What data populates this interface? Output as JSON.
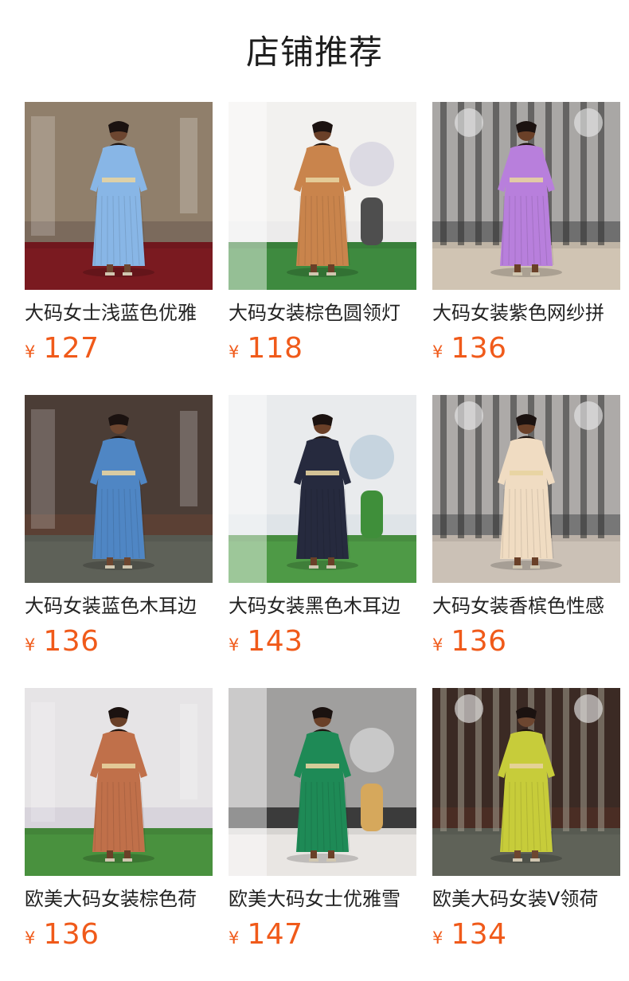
{
  "header": {
    "title": "店铺推荐"
  },
  "currency_symbol": "¥",
  "colors": {
    "price": "#f05a1a",
    "text": "#222222"
  },
  "products": [
    {
      "name": "大码女士浅蓝色优雅",
      "price": "127",
      "image": "woman-light-blue-dress-photo",
      "scene": {
        "bg": "#7b6a5c",
        "floor": "#7a1a20",
        "wall": "#a29078",
        "dress": "#88b6e6",
        "skin": "#6d4630",
        "accent": "#efe7da",
        "plants": "#2d7a34"
      }
    },
    {
      "name": "大码女装棕色圆领灯",
      "price": "118",
      "image": "woman-brown-pleated-dress-photo",
      "scene": {
        "bg": "#ecebeb",
        "floor": "#3e8a3f",
        "wall": "#f7f5f2",
        "dress": "#c9844c",
        "skin": "#6a4028",
        "accent": "#d8d6e0",
        "plants": "#4e4e4e"
      }
    },
    {
      "name": "大码女装紫色网纱拼",
      "price": "136",
      "image": "woman-purple-gown-photo",
      "scene": {
        "bg": "#6f6f6f",
        "floor": "#d0c4b3",
        "wall": "#d9d6d1",
        "dress": "#b87fdc",
        "skin": "#6a4028",
        "accent": "#2e2e2e",
        "plants": "#9a8870"
      }
    },
    {
      "name": "大码女装蓝色木耳边",
      "price": "136",
      "image": "woman-blue-ruffle-dress-photo",
      "scene": {
        "bg": "#5b4034",
        "floor": "#5e6158",
        "wall": "#3e3b38",
        "dress": "#4f86c4",
        "skin": "#6d4630",
        "accent": "#d7d0c8",
        "plants": "#4b9a3e"
      }
    },
    {
      "name": "大码女装黑色木耳边",
      "price": "143",
      "image": "woman-black-pleated-dress-photo",
      "scene": {
        "bg": "#dfe4e8",
        "floor": "#4e9a46",
        "wall": "#f1f1f1",
        "dress": "#262a3e",
        "skin": "#6a4028",
        "accent": "#bfd0dc",
        "plants": "#3f8f3a"
      }
    },
    {
      "name": "大码女装香槟色性感",
      "price": "136",
      "image": "woman-champagne-gown-photo",
      "scene": {
        "bg": "#777777",
        "floor": "#cbc1b6",
        "wall": "#dad6d1",
        "dress": "#f0dcc2",
        "skin": "#6a4028",
        "accent": "#2e2e2e",
        "plants": "#a89276"
      }
    },
    {
      "name": "欧美大码女装棕色荷",
      "price": "136",
      "image": "woman-rust-pleated-dress-photo",
      "scene": {
        "bg": "#d8d4dc",
        "floor": "#49913e",
        "wall": "#f3f1ef",
        "dress": "#c0704a",
        "skin": "#6a4028",
        "accent": "#8b7f94",
        "plants": "#4d4d4d"
      }
    },
    {
      "name": "欧美大码女士优雅雪",
      "price": "147",
      "image": "woman-green-ruffle-dress-photo",
      "scene": {
        "bg": "#3b3b3b",
        "floor": "#e9e6e3",
        "wall": "#f4f2f0",
        "dress": "#1e8a56",
        "skin": "#6a4028",
        "accent": "#cfcfcf",
        "plants": "#d6a85c"
      }
    },
    {
      "name": "欧美大码女装V领荷",
      "price": "134",
      "image": "woman-chartreuse-ruffle-dress-photo",
      "scene": {
        "bg": "#4a2d24",
        "floor": "#5f6258",
        "wall": "#2f2825",
        "dress": "#c7cc3a",
        "skin": "#6d4630",
        "accent": "#a09a8c",
        "plants": "#4a9a3e"
      }
    }
  ]
}
